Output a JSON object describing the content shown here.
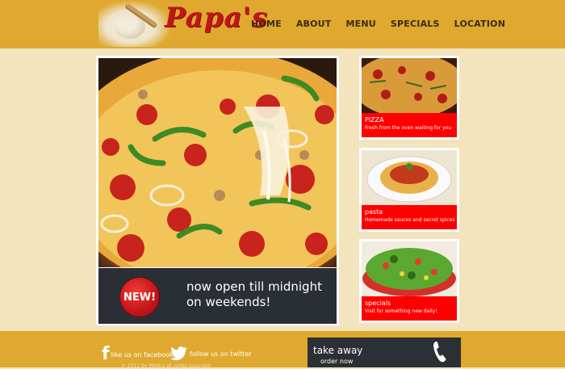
{
  "header": {
    "logo_text": "Papa's",
    "nav": [
      "HOME",
      "ABOUT",
      "MENU",
      "SPECIALS",
      "LOCATION"
    ]
  },
  "hero": {
    "badge": "NEW!",
    "caption_line1": "now open till midnight",
    "caption_line2": "on weekends!"
  },
  "side": [
    {
      "title": "PIZZA",
      "desc": "Fresh from the oven waiting for you"
    },
    {
      "title": "pasta",
      "desc": "Homemade sauces and secret spices"
    },
    {
      "title": "specials",
      "desc": "Visit for something new daily!"
    }
  ],
  "footer": {
    "facebook": "like us on facebook",
    "twitter": "follow us on twitter",
    "copyright": "© 2012 by PAPA's all rights reserved",
    "takeaway_title": "take away",
    "takeaway_sub": "order now"
  },
  "colors": {
    "header": "#dfa92f",
    "background": "#f3e4bd",
    "accent_red": "#ff0000",
    "dark_panel": "#2b2f36"
  },
  "icons": [
    "rolling-pin-logo",
    "facebook-icon",
    "twitter-bird-icon",
    "phone-icon"
  ]
}
